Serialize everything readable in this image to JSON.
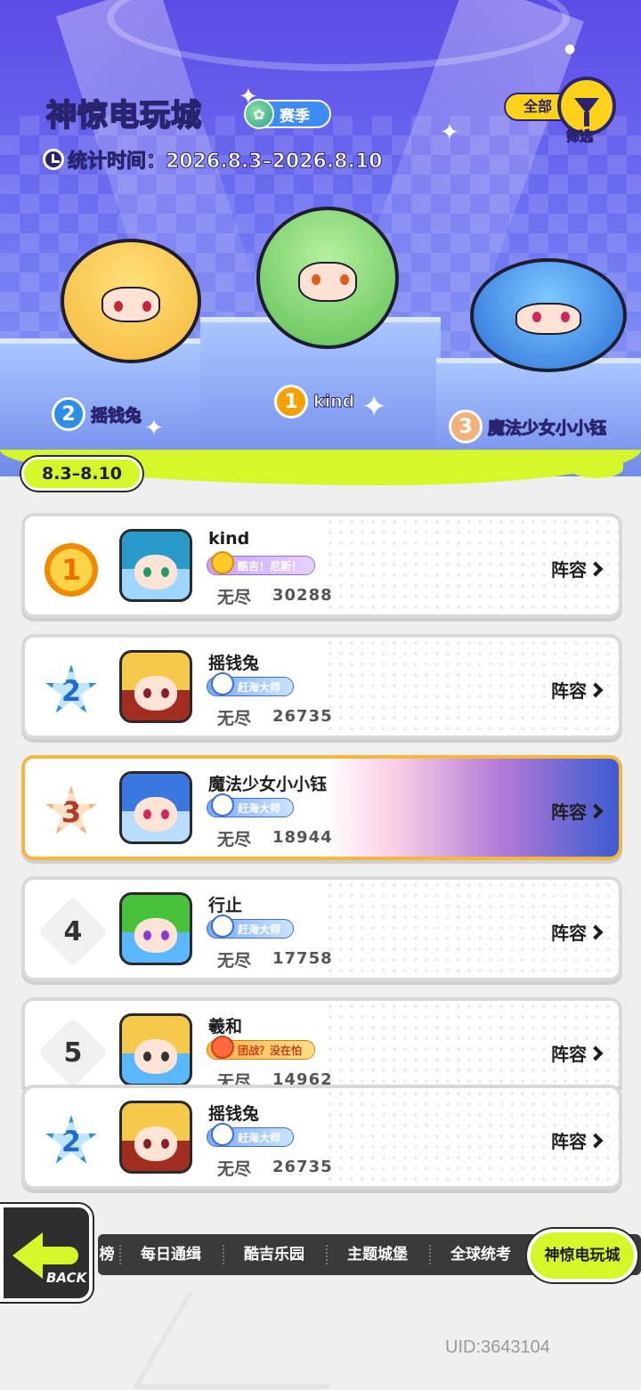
{
  "header": {
    "title": "神惊电玩城",
    "season_label": "赛季",
    "stat_time": "统计时间：2026.8.3–2026.8.10",
    "filter_all": "全部",
    "filter_label": "筛选"
  },
  "podium": {
    "first": {
      "rank": "1",
      "name": "kind"
    },
    "second": {
      "rank": "2",
      "name": "摇钱兔"
    },
    "third": {
      "rank": "3",
      "name": "魔法少女小小钰"
    }
  },
  "date_range": "8.3–8.10",
  "rows": [
    {
      "rank": "1",
      "name": "kind",
      "badge": "酷吉！尼斯！",
      "mode": "无尽",
      "score": "30288",
      "lineup": "阵容"
    },
    {
      "rank": "2",
      "name": "摇钱兔",
      "badge": "赶海大师",
      "mode": "无尽",
      "score": "26735",
      "lineup": "阵容"
    },
    {
      "rank": "3",
      "name": "魔法少女小小钰",
      "badge": "赶海大师",
      "mode": "无尽",
      "score": "18944",
      "lineup": "阵容"
    },
    {
      "rank": "4",
      "name": "行止",
      "badge": "赶海大师",
      "mode": "无尽",
      "score": "17758",
      "lineup": "阵容"
    },
    {
      "rank": "5",
      "name": "羲和",
      "badge": "团战？没在怕",
      "mode": "无尽",
      "score": "14962",
      "lineup": "阵容"
    }
  ],
  "my_row": {
    "rank": "2",
    "name": "摇钱兔",
    "badge": "赶海大师",
    "mode": "无尽",
    "score": "26735",
    "lineup": "阵容"
  },
  "nav": {
    "partial_tab": "榜",
    "tabs": [
      "每日通缉",
      "酷吉乐园",
      "主题城堡",
      "全球统考"
    ],
    "active_tab": "神惊电玩城",
    "back_label": "BACK"
  },
  "uid": "UID:3643104",
  "colors": {
    "accent": "#d5f72a",
    "hero": "#5d4be6",
    "gold_border": "#f5b541"
  }
}
